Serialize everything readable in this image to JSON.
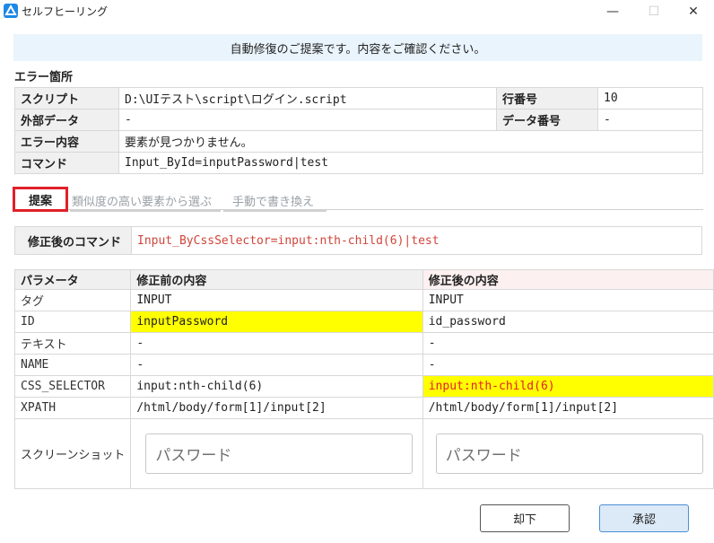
{
  "window": {
    "title": "セルフヒーリング",
    "minimize": "—",
    "maximize": "☐",
    "close": "✕"
  },
  "banner": "自動修復のご提案です。内容をご確認ください。",
  "error_section": {
    "label": "エラー箇所",
    "script_label": "スクリプト",
    "script_value": "D:\\UIテスト\\script\\ログイン.script",
    "line_label": "行番号",
    "line_value": "10",
    "external_label": "外部データ",
    "external_value": "-",
    "datano_label": "データ番号",
    "datano_value": "-",
    "error_label": "エラー内容",
    "error_value": "要素が見つかりません。",
    "command_label": "コマンド",
    "command_value": "Input_ById=inputPassword|test"
  },
  "tabs": {
    "proposal": "提案",
    "similar": "類似度の高い要素から選ぶ",
    "manual": "手動で書き換え"
  },
  "corrected": {
    "label": "修正後のコマンド",
    "value": "Input_ByCssSelector=input:nth-child(6)|test"
  },
  "comparison": {
    "headers": [
      "パラメータ",
      "修正前の内容",
      "修正後の内容"
    ],
    "rows": [
      {
        "param": "タグ",
        "before": "INPUT",
        "after": "INPUT"
      },
      {
        "param": "ID",
        "before": "inputPassword",
        "after": "id_password"
      },
      {
        "param": "テキスト",
        "before": "-",
        "after": "-"
      },
      {
        "param": "NAME",
        "before": "-",
        "after": "-"
      },
      {
        "param": "CSS_SELECTOR",
        "before": "input:nth-child(6)",
        "after": "input:nth-child(6)"
      },
      {
        "param": "XPATH",
        "before": "/html/body/form[1]/input[2]",
        "after": "/html/body/form[1]/input[2]"
      }
    ],
    "screenshot_label": "スクリーンショット",
    "before_placeholder": "パスワード",
    "after_placeholder": "パスワード"
  },
  "buttons": {
    "reject": "却下",
    "approve": "承認"
  },
  "colors": {
    "highlight": "#ffff00",
    "active_tab_border": "#e0202a",
    "corrected_text": "#d0453a"
  }
}
